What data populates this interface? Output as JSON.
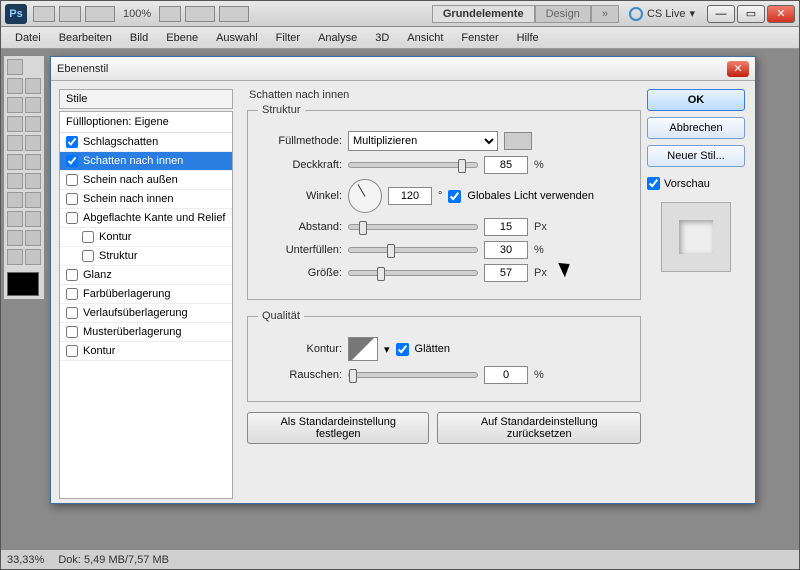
{
  "titlebar": {
    "zoom": "100%",
    "ws_tabs": [
      "Grundelemente",
      "Design"
    ],
    "cslive": "CS Live"
  },
  "menus": [
    "Datei",
    "Bearbeiten",
    "Bild",
    "Ebene",
    "Auswahl",
    "Filter",
    "Analyse",
    "3D",
    "Ansicht",
    "Fenster",
    "Hilfe"
  ],
  "dialog": {
    "title": "Ebenenstil",
    "styles_header": "Stile",
    "fill_opts": "Füllloptionen: Eigene",
    "items": [
      {
        "label": "Schlagschatten",
        "checked": true
      },
      {
        "label": "Schatten nach innen",
        "checked": true,
        "selected": true
      },
      {
        "label": "Schein nach außen",
        "checked": false
      },
      {
        "label": "Schein nach innen",
        "checked": false
      },
      {
        "label": "Abgeflachte Kante und Relief",
        "checked": false
      },
      {
        "label": "Kontur",
        "checked": false,
        "indent": true
      },
      {
        "label": "Struktur",
        "checked": false,
        "indent": true
      },
      {
        "label": "Glanz",
        "checked": false
      },
      {
        "label": "Farbüberlagerung",
        "checked": false
      },
      {
        "label": "Verlaufsüberlagerung",
        "checked": false
      },
      {
        "label": "Musterüberlagerung",
        "checked": false
      },
      {
        "label": "Kontur",
        "checked": false
      }
    ],
    "group_caption": "Schatten nach innen",
    "struktur_legend": "Struktur",
    "fuellmethode_lbl": "Füllmethode:",
    "fuellmethode_val": "Multiplizieren",
    "deckkraft_lbl": "Deckkraft:",
    "deckkraft_val": "85",
    "pct": "%",
    "winkel_lbl": "Winkel:",
    "winkel_val": "120",
    "deg": "°",
    "global_light": "Globales Licht verwenden",
    "abstand_lbl": "Abstand:",
    "abstand_val": "15",
    "px": "Px",
    "unterfuellen_lbl": "Unterfüllen:",
    "unterfuellen_val": "30",
    "groesse_lbl": "Größe:",
    "groesse_val": "57",
    "qualitaet_legend": "Qualität",
    "kontur_lbl": "Kontur:",
    "glaetten": "Glätten",
    "rauschen_lbl": "Rauschen:",
    "rauschen_val": "0",
    "btn_default": "Als Standardeinstellung festlegen",
    "btn_reset": "Auf Standardeinstellung zurücksetzen",
    "ok": "OK",
    "cancel": "Abbrechen",
    "newstyle": "Neuer Stil...",
    "vorschau": "Vorschau"
  },
  "status": {
    "zoom": "33,33%",
    "doc": "Dok: 5,49 MB/7,57 MB"
  }
}
